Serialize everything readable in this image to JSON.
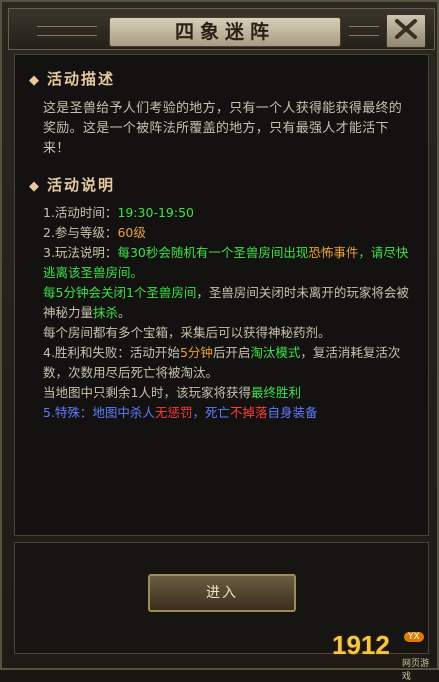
{
  "window": {
    "title": "四象迷阵",
    "close_symbol": "✕"
  },
  "description_section": {
    "title": "活动描述",
    "text": "这是圣兽给予人们考验的地方，只有一个人获得能获得最终的奖励。这是一个被阵法所覆盖的地方，只有最强人才能活下来！"
  },
  "rules_section": {
    "title": "活动说明",
    "line1_label": "1.活动时间：",
    "line1_value": "19:30-19:50",
    "line2_label": "2.参与等级：",
    "line2_value": "60级",
    "line3_a": "3.玩法说明：",
    "line3_b": "每30秒会随机有一个圣兽房间出现",
    "line3_c": "恐怖事件",
    "line3_d": "，请尽快逃离该圣兽房间。",
    "line4_a": "每5分钟会关闭1个圣兽房间",
    "line4_b": "，圣兽房间关闭时未离开的玩家将会被神秘力量",
    "line4_c": "抹杀",
    "line4_d": "。",
    "line5": "每个房间都有多个宝箱，采集后可以获得神秘药剂。",
    "line6_a": "4.胜利和失败：活动开始",
    "line6_b": "5分钟",
    "line6_c": "后开启",
    "line6_d": "淘汰模式",
    "line6_e": "，复活消耗复活次数，次数用尽后死亡将被淘汰。",
    "line7_a": "当地图中只剩余1人时，该玩家将获得",
    "line7_b": "最终胜利",
    "line8_a": "5.特殊：地图中杀人",
    "line8_b": "无惩罚",
    "line8_c": "，死亡",
    "line8_d": "不掉落",
    "line8_e": "自身装备"
  },
  "enter_button": {
    "label": "进入"
  },
  "watermark": {
    "number": "1912",
    "badge": "YX",
    "sub": "网页游戏"
  },
  "colors": {
    "accent_green": "#3ee04a",
    "accent_orange": "#e8a23a",
    "accent_red": "#ff3a3a",
    "accent_blue": "#5b7cff",
    "section_title": "#e7c9a0"
  }
}
